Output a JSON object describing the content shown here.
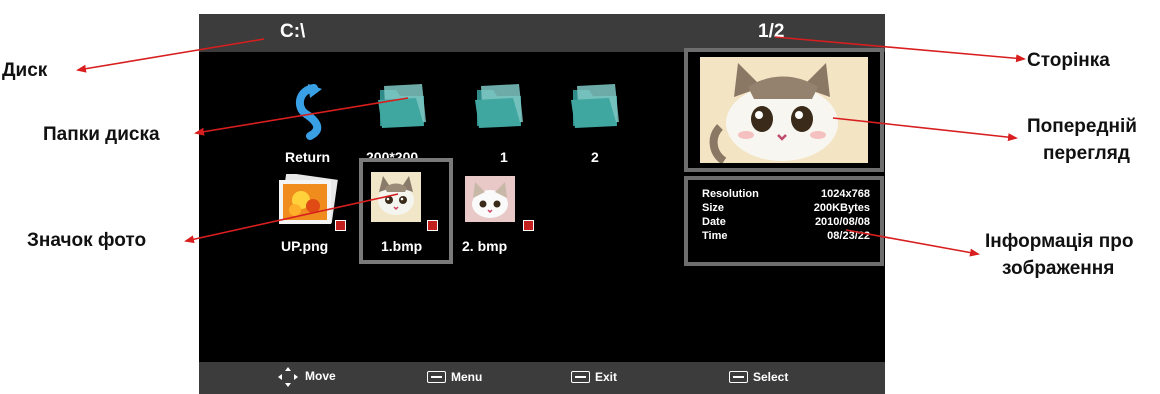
{
  "screen": {
    "drive": "C:\\",
    "page": "1/2",
    "folders": [
      {
        "label": "Return",
        "icon": "return-arrow-icon"
      },
      {
        "label": "200*200",
        "icon": "folder-icon"
      },
      {
        "label": "1",
        "icon": "folder-icon"
      },
      {
        "label": "2",
        "icon": "folder-icon"
      }
    ],
    "photos": [
      {
        "label": "UP.png",
        "icon": "photo-stack-icon"
      },
      {
        "label": "1.bmp",
        "icon": "cat-photo-icon",
        "selected": true
      },
      {
        "label": "2. bmp",
        "icon": "cat-photo-icon"
      }
    ],
    "info": [
      {
        "key": "Resolution",
        "value": "1024x768"
      },
      {
        "key": "Size",
        "value": "200KBytes"
      },
      {
        "key": "Date",
        "value": "2010/08/08"
      },
      {
        "key": "Time",
        "value": "08/23/22"
      }
    ],
    "hints": [
      {
        "label": "Move",
        "icon": "four-way-arrow-icon"
      },
      {
        "label": "Menu",
        "icon": "menu-key-icon"
      },
      {
        "label": "Exit",
        "icon": "exit-key-icon"
      },
      {
        "label": "Select",
        "icon": "ok-key-icon"
      }
    ]
  },
  "annotations": {
    "disk": "Диск",
    "folders": "Папки диска",
    "photo_icon": "Значок фото",
    "page": "Сторінка",
    "preview_1": "Попередній",
    "preview_2": "перегляд",
    "info_1": "Інформація про",
    "info_2": "зображення"
  },
  "colors": {
    "arrow": "#d81e1e",
    "bar": "#3c3c3c",
    "frame": "#6e6e6e"
  }
}
